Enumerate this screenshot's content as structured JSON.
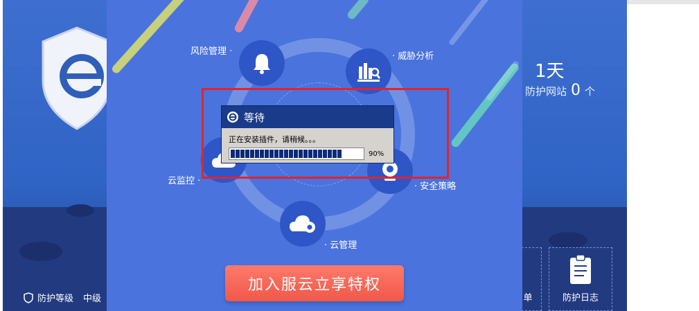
{
  "overlay": {
    "nodes": [
      {
        "label": "风险管理 ·",
        "icon": "bell-icon"
      },
      {
        "label": "· 威胁分析",
        "icon": "analysis-icon"
      },
      {
        "label": "云监控 ·",
        "icon": "cloud-monitor-icon"
      },
      {
        "label": "· 安全策略",
        "icon": "camera-icon"
      },
      {
        "label": "· 云管理",
        "icon": "cloud-gear-icon"
      }
    ],
    "cta": "加入服云立享特权"
  },
  "dialog": {
    "title": "等待",
    "message": "正在安装插件，请稍候。。。",
    "progress": 0.9,
    "progress_label": "90%"
  },
  "background": {
    "status_label": "防护等级",
    "status_level": "中级",
    "days": "1天",
    "sites_label": "防护网站",
    "sites_count": "0",
    "sites_unit": "个",
    "tool_partial_label": "单",
    "tool_log_label": "防护日志"
  }
}
